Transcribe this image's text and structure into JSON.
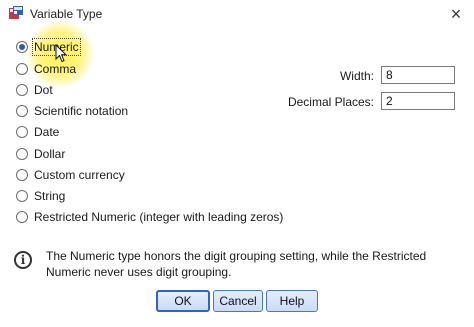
{
  "window": {
    "title": "Variable Type",
    "close_glyph": "×",
    "app_icon": "spss-variable-icon"
  },
  "types": [
    {
      "label": "Numeric",
      "checked": true
    },
    {
      "label": "Comma",
      "checked": false
    },
    {
      "label": "Dot",
      "checked": false
    },
    {
      "label": "Scientific notation",
      "checked": false
    },
    {
      "label": "Date",
      "checked": false
    },
    {
      "label": "Dollar",
      "checked": false
    },
    {
      "label": "Custom currency",
      "checked": false
    },
    {
      "label": "String",
      "checked": false
    },
    {
      "label": "Restricted Numeric (integer with leading zeros)",
      "checked": false
    }
  ],
  "fields": {
    "width_label": "Width:",
    "width_value": "8",
    "decimals_label": "Decimal Places:",
    "decimals_value": "2"
  },
  "info": {
    "icon": "info-icon",
    "text": "The Numeric type honors the digit grouping setting, while the Restricted Numeric never uses digit grouping."
  },
  "buttons": {
    "ok": "OK",
    "cancel": "Cancel",
    "help": "Help"
  },
  "colors": {
    "accent": "#2f63c8",
    "button_fill": "#c9dbf7",
    "highlight": "#fff046"
  }
}
